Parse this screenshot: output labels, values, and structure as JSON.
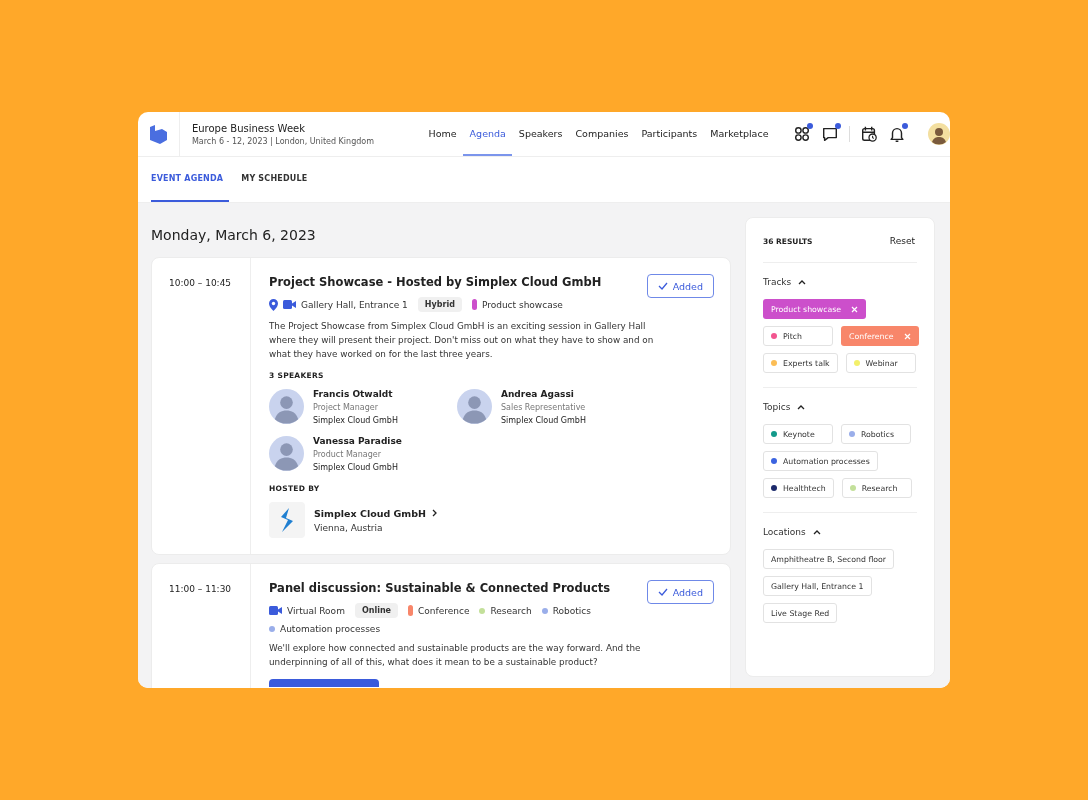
{
  "event": {
    "name": "Europe Business Week",
    "subtitle": "March 6 - 12, 2023 | London, United Kingdom"
  },
  "nav": [
    {
      "label": "Home",
      "selected": false
    },
    {
      "label": "Agenda",
      "selected": true
    },
    {
      "label": "Speakers",
      "selected": false
    },
    {
      "label": "Companies",
      "selected": false
    },
    {
      "label": "Participants",
      "selected": false
    },
    {
      "label": "Marketplace",
      "selected": false
    }
  ],
  "header_icons": [
    {
      "kind": "apps",
      "badge": true
    },
    {
      "kind": "chat",
      "badge": true
    },
    {
      "kind": "calendar",
      "badge": false
    },
    {
      "kind": "bell",
      "badge": true
    }
  ],
  "subtabs": [
    {
      "label": "EVENT AGENDA",
      "selected": true
    },
    {
      "label": "MY SCHEDULE",
      "selected": false
    }
  ],
  "date_heading": "Monday, March 6, 2023",
  "sessions": [
    {
      "time": "10:00 – 10:45",
      "title": "Project Showcase - Hosted by Simplex Cloud GmbH",
      "venue_icons": [
        {
          "kind": "pin"
        },
        {
          "kind": "video"
        }
      ],
      "venue": "Gallery Hall, Entrance 1",
      "mode": "Hybrid",
      "tags": [
        {
          "kind": "track",
          "label": "Product showcase",
          "color": "#cc4fcb"
        }
      ],
      "action": "Added",
      "description": "The Project Showcase from Simplex Cloud GmbH is an exciting session in Gallery Hall where they will present their project. Don't miss out on what they have to show and on what they have worked on for the last three years.",
      "speakers_heading": "3 SPEAKERS",
      "speakers": [
        {
          "name": "Francis Otwaldt",
          "role": "Project Manager",
          "company": "Simplex Cloud GmbH"
        },
        {
          "name": "Andrea Agassi",
          "role": "Sales Representative",
          "company": "Simplex Cloud GmbH"
        },
        {
          "name": "Vanessa Paradise",
          "role": "Product Manager",
          "company": "Simplex Cloud GmbH"
        }
      ],
      "host_heading": "HOSTED BY",
      "host": {
        "name": "Simplex Cloud GmbH",
        "location": "Vienna, Austria"
      }
    },
    {
      "time": "11:00 – 11:30",
      "title": "Panel discussion: Sustainable & Connected Products",
      "venue_icons": [
        {
          "kind": "video"
        }
      ],
      "venue": "Virtual Room",
      "mode": "Online",
      "tags": [
        {
          "kind": "track",
          "label": "Conference",
          "color": "#f8866a"
        },
        {
          "kind": "topic",
          "label": "Research",
          "color": "#c3e09a"
        },
        {
          "kind": "topic",
          "label": "Robotics",
          "color": "#9aaeea"
        },
        {
          "kind": "topic",
          "label": "Automation processes",
          "color": "#9aaeea"
        }
      ],
      "action": "Added",
      "description": "We'll explore how connected and sustainable products are the way forward. And the underpinning of all of this, what does it mean to be a sustainable product?",
      "button_visible": true
    }
  ],
  "filters": {
    "results": "36 RESULTS",
    "reset": "Reset",
    "groups": [
      {
        "title": "Tracks",
        "expanded": true,
        "chips": [
          {
            "label": "Product showcase",
            "color": "#cc4fcb",
            "selected": true
          },
          {
            "label": "Pitch",
            "color": "#f2558f",
            "selected": false
          },
          {
            "label": "Conference",
            "color": "#f8866a",
            "selected": true
          },
          {
            "label": "Experts talk",
            "color": "#fbbd55",
            "selected": false
          },
          {
            "label": "Webinar",
            "color": "#f3f06a",
            "selected": false
          }
        ]
      },
      {
        "title": "Topics",
        "expanded": true,
        "chips": [
          {
            "label": "Keynote",
            "color": "#13998a",
            "selected": false
          },
          {
            "label": "Robotics",
            "color": "#9aaeea",
            "selected": false
          },
          {
            "label": "Automation processes",
            "color": "#3b63e0",
            "selected": false
          },
          {
            "label": "Healthtech",
            "color": "#1c2a6b",
            "selected": false
          },
          {
            "label": "Research",
            "color": "#c3e09a",
            "selected": false
          }
        ]
      },
      {
        "title": "Locations",
        "expanded": true,
        "chips": [
          {
            "label": "Amphitheatre B, Second floor",
            "selected": false
          },
          {
            "label": "Gallery Hall, Entrance 1",
            "selected": false
          },
          {
            "label": "Live Stage Red",
            "selected": false
          }
        ]
      }
    ]
  }
}
